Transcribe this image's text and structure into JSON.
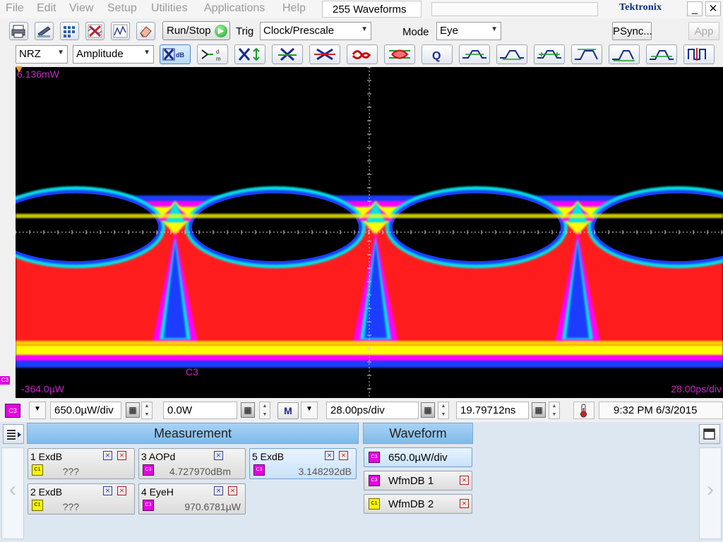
{
  "menu": {
    "items": [
      "File",
      "Edit",
      "View",
      "Setup",
      "Utilities",
      "Applications",
      "Help"
    ],
    "waveform_count": "255 Waveforms",
    "brand": "Tektronix",
    "window_buttons": {
      "minimize": "_",
      "restore": "□",
      "close": "✕"
    }
  },
  "toolbar": {
    "run_stop_label": "Run/Stop",
    "trig_label": "Trig",
    "trig_value": "Clock/Prescale",
    "mode_label": "Mode",
    "mode_value": "Eye",
    "psync_label": "PSync...",
    "app_label": "App",
    "icons": [
      "print-icon",
      "scanner-icon",
      "measure-icon",
      "clear-icon",
      "autoset-icon",
      "eraser-icon"
    ]
  },
  "toolbar2": {
    "signal_type": "NRZ",
    "measure_type": "Amplitude",
    "icons": [
      "extinction-ratio-db-icon",
      "crossing-meas-icon",
      "eye-height-icon",
      "eye-width-icon",
      "eye-crossing-icon",
      "jitter-icon",
      "noise-icon",
      "q-factor-icon",
      "rise-icon",
      "fall-icon",
      "pulse-icon",
      "high-icon",
      "low-icon",
      "cross-icon",
      "bit-icon"
    ]
  },
  "screen": {
    "top_label": "6.136mW",
    "bottom_label": "-364.0µW",
    "channel_label": "C3",
    "timebase_label": "28.00ps/div",
    "colors": {
      "background": "#000000",
      "yellow": "#ffff00",
      "red": "#ff1a1a",
      "magenta": "#ff00ff",
      "cyan": "#00e5e5",
      "blue": "#1a3cff",
      "grid": "#c8c8c8"
    }
  },
  "status": {
    "channel": "C3",
    "vertical_scale": "650.0µW/div",
    "offset": "0.0W",
    "math_label": "M",
    "horizontal_scale": "28.00ps/div",
    "position": "19.79712ns",
    "datetime": "9:32 PM 6/3/2015"
  },
  "measurement_panel": {
    "title": "Measurement",
    "items": [
      {
        "name": "1 ExdB",
        "source": "C1",
        "value": "???"
      },
      {
        "name": "2 ExdB",
        "source": "C1",
        "value": "???"
      },
      {
        "name": "3 AOPd",
        "source": "C3",
        "value": "4.727970dBm"
      },
      {
        "name": "4 EyeH",
        "source": "C3",
        "value": "970.6781µW"
      },
      {
        "name": "5 ExdB",
        "source": "C3",
        "value": "3.148292dB"
      }
    ]
  },
  "waveform_panel": {
    "title": "Waveform",
    "items": [
      {
        "source": "C3",
        "label": "650.0µW/div"
      },
      {
        "source": "C3",
        "label": "WfmDB 1"
      },
      {
        "source": "C1",
        "label": "WfmDB 2"
      }
    ]
  }
}
